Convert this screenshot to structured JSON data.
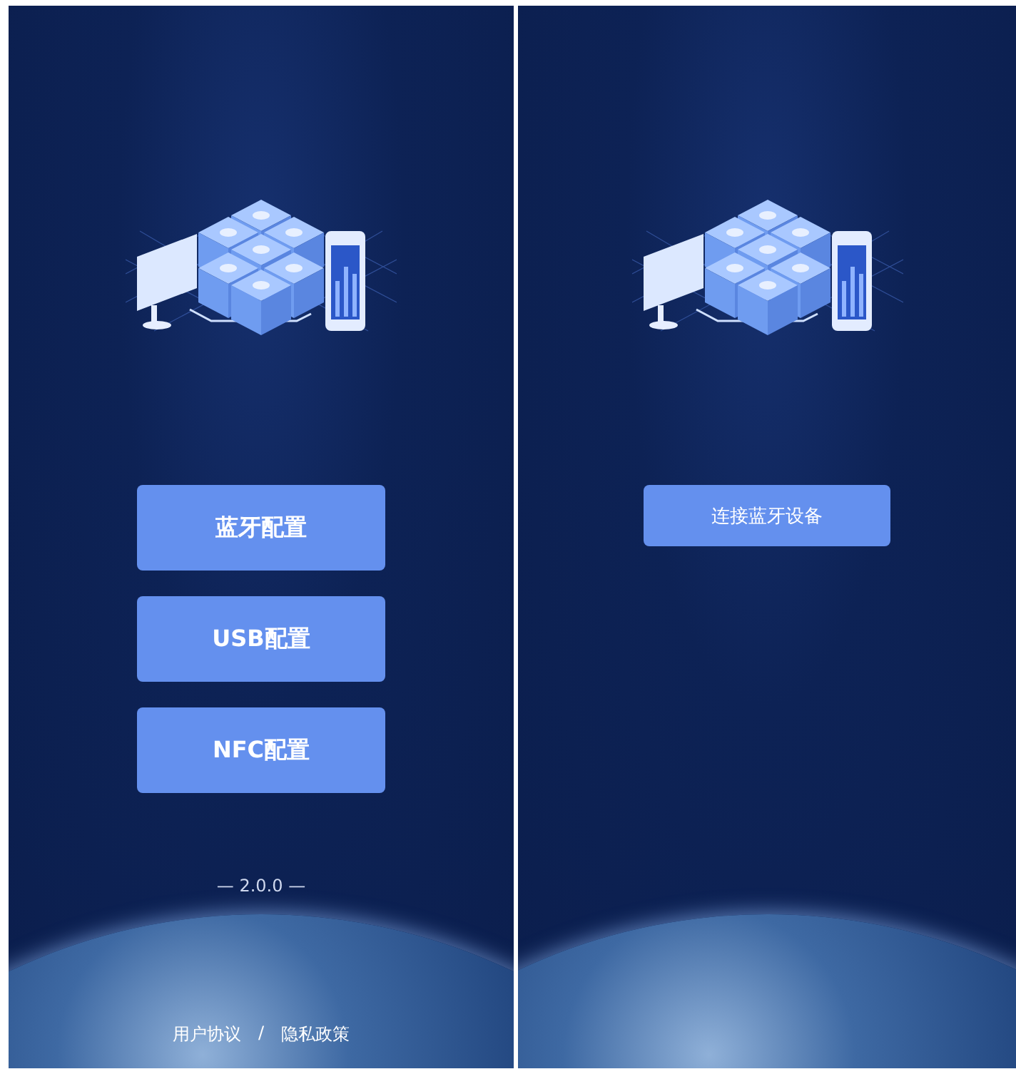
{
  "screens": [
    {
      "kind": "menu",
      "buttons": [
        "蓝牙配置",
        "USB配置",
        "NFC配置"
      ],
      "version": "— 2.0.0 —",
      "footer_links": [
        "用户协议",
        "隐私政策"
      ],
      "footer_separator": "/"
    },
    {
      "kind": "connect",
      "buttons": [
        "连接蓝牙设备"
      ]
    }
  ]
}
